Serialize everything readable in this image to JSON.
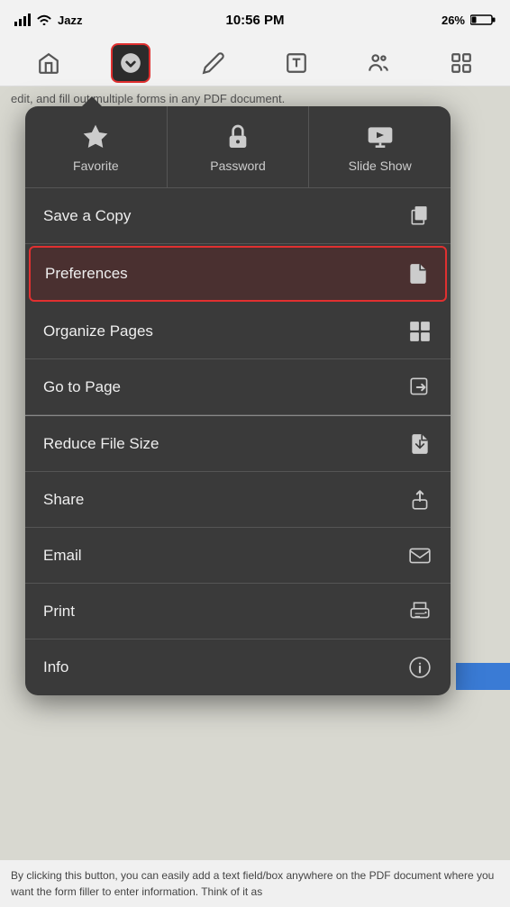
{
  "status_bar": {
    "carrier": "Jazz",
    "time": "10:56 PM",
    "battery_pct": "26%"
  },
  "toolbar": {
    "items": [
      {
        "name": "home",
        "label": "Home"
      },
      {
        "name": "dropdown",
        "label": "Dropdown"
      },
      {
        "name": "edit-pen",
        "label": "Edit Pen"
      },
      {
        "name": "text-tool",
        "label": "Text Tool"
      },
      {
        "name": "people",
        "label": "People"
      },
      {
        "name": "grid",
        "label": "Grid"
      }
    ]
  },
  "bg_text": "edit, and fill out multiple forms in any PDF document.",
  "dropdown": {
    "top_actions": [
      {
        "name": "favorite",
        "label": "Favorite"
      },
      {
        "name": "password",
        "label": "Password"
      },
      {
        "name": "slide-show",
        "label": "Slide Show"
      }
    ],
    "menu_items": [
      {
        "name": "save-a-copy",
        "label": "Save a Copy"
      },
      {
        "name": "preferences",
        "label": "Preferences",
        "highlighted": true
      },
      {
        "name": "organize-pages",
        "label": "Organize Pages"
      },
      {
        "name": "go-to-page",
        "label": "Go to Page"
      },
      {
        "name": "reduce-file-size",
        "label": "Reduce File Size"
      },
      {
        "name": "share",
        "label": "Share"
      },
      {
        "name": "email",
        "label": "Email"
      },
      {
        "name": "print",
        "label": "Print"
      },
      {
        "name": "info",
        "label": "Info"
      }
    ]
  },
  "bottom_text": "By clicking this button, you can easily add a text field/box anywhere on the PDF document where you want the form filler to enter information. Think of it as"
}
